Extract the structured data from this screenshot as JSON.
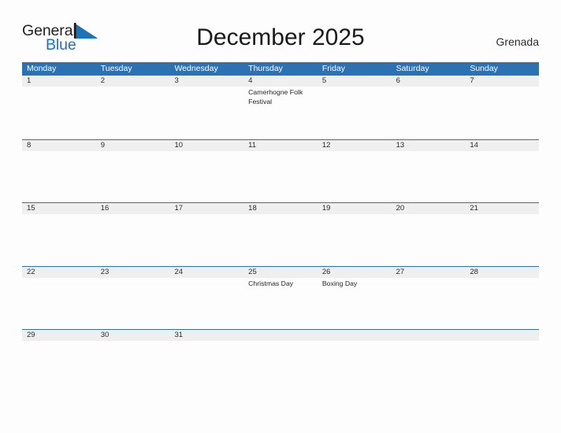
{
  "logo": {
    "word_one": "General",
    "word_two": "Blue",
    "flag_color": "#1e72b8",
    "text_color": "#231f20"
  },
  "header": {
    "title": "December 2025",
    "country": "Grenada"
  },
  "theme": {
    "header_blue": "#2c72b3",
    "band_gray": "#efefef",
    "page_background": "#fdfdfd",
    "text_dark": "#2b2b2b"
  },
  "calendar": {
    "weekdays": [
      "Monday",
      "Tuesday",
      "Wednesday",
      "Thursday",
      "Friday",
      "Saturday",
      "Sunday"
    ],
    "weeks": [
      [
        {
          "day": "1",
          "events": []
        },
        {
          "day": "2",
          "events": []
        },
        {
          "day": "3",
          "events": []
        },
        {
          "day": "4",
          "events": [
            "Camerhogne Folk Festival"
          ]
        },
        {
          "day": "5",
          "events": []
        },
        {
          "day": "6",
          "events": []
        },
        {
          "day": "7",
          "events": []
        }
      ],
      [
        {
          "day": "8",
          "events": []
        },
        {
          "day": "9",
          "events": []
        },
        {
          "day": "10",
          "events": []
        },
        {
          "day": "11",
          "events": []
        },
        {
          "day": "12",
          "events": []
        },
        {
          "day": "13",
          "events": []
        },
        {
          "day": "14",
          "events": []
        }
      ],
      [
        {
          "day": "15",
          "events": []
        },
        {
          "day": "16",
          "events": []
        },
        {
          "day": "17",
          "events": []
        },
        {
          "day": "18",
          "events": []
        },
        {
          "day": "19",
          "events": []
        },
        {
          "day": "20",
          "events": []
        },
        {
          "day": "21",
          "events": []
        }
      ],
      [
        {
          "day": "22",
          "events": []
        },
        {
          "day": "23",
          "events": []
        },
        {
          "day": "24",
          "events": []
        },
        {
          "day": "25",
          "events": [
            "Christmas Day"
          ]
        },
        {
          "day": "26",
          "events": [
            "Boxing Day"
          ]
        },
        {
          "day": "27",
          "events": []
        },
        {
          "day": "28",
          "events": []
        }
      ],
      [
        {
          "day": "29",
          "events": []
        },
        {
          "day": "30",
          "events": []
        },
        {
          "day": "31",
          "events": []
        },
        {
          "day": "",
          "events": []
        },
        {
          "day": "",
          "events": []
        },
        {
          "day": "",
          "events": []
        },
        {
          "day": "",
          "events": []
        }
      ]
    ]
  }
}
